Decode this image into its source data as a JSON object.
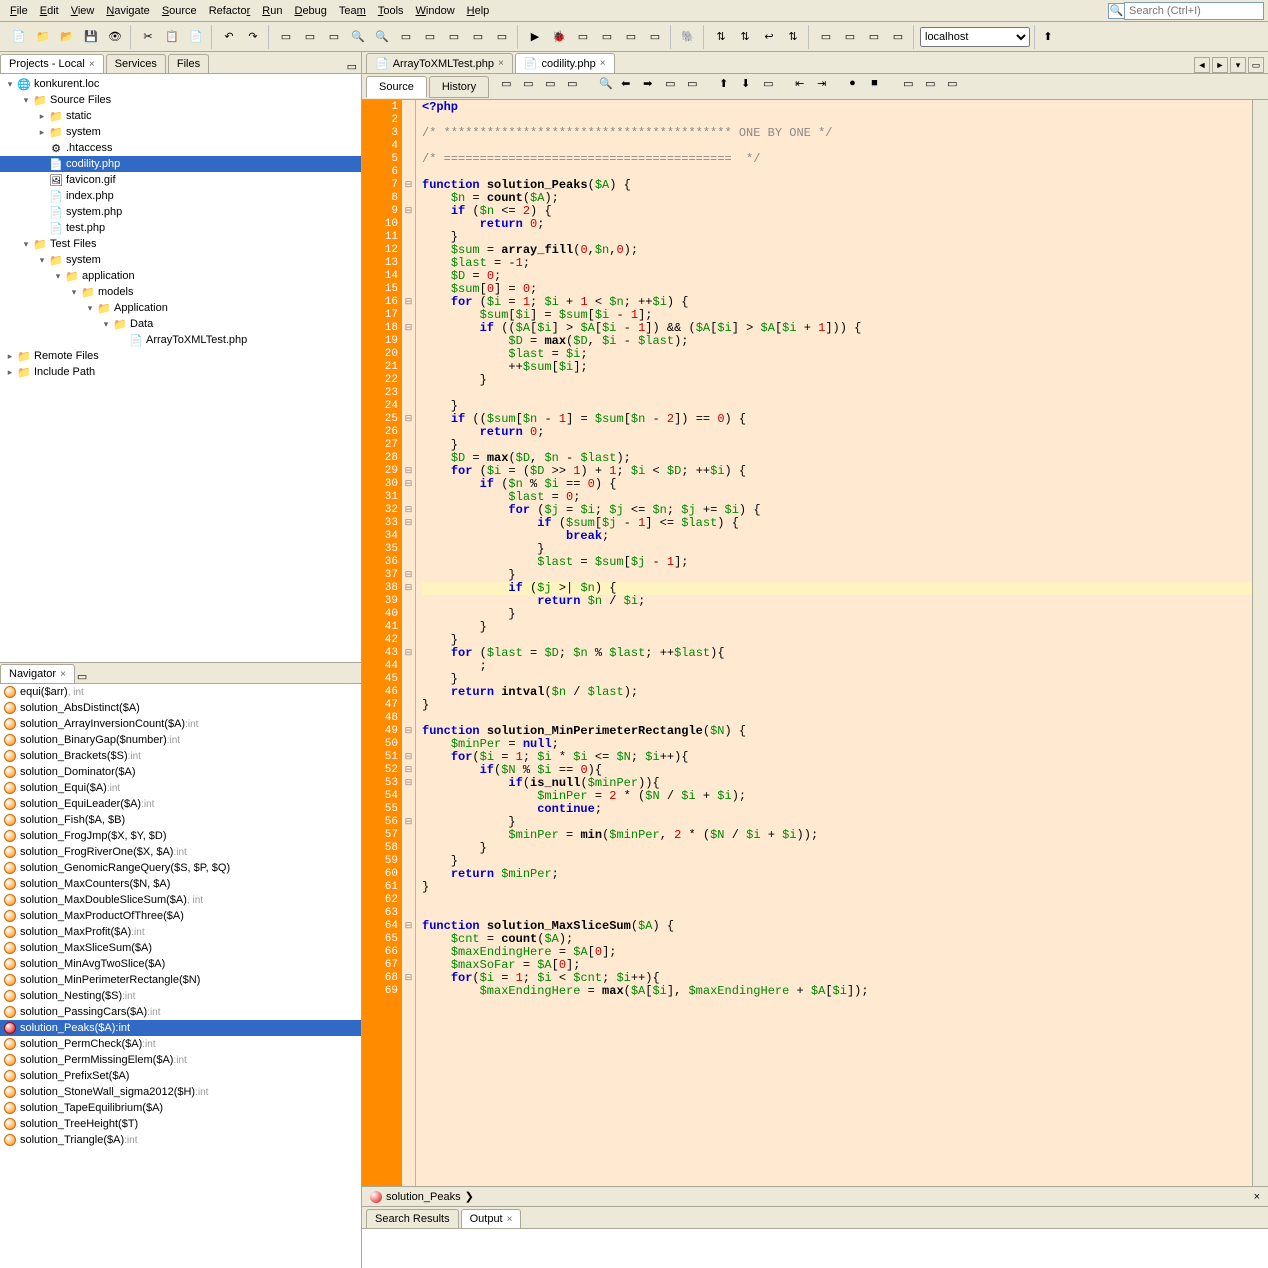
{
  "menu": [
    "File",
    "Edit",
    "View",
    "Navigate",
    "Source",
    "Refactor",
    "Run",
    "Debug",
    "Team",
    "Tools",
    "Window",
    "Help"
  ],
  "search_placeholder": "Search (Ctrl+I)",
  "host_select": "localhost",
  "left_tabs": {
    "projects": "Projects - Local",
    "services": "Services",
    "files": "Files"
  },
  "project_tree": [
    {
      "indent": 0,
      "toggle": "▾",
      "icon": "project",
      "label": "konkurent.loc"
    },
    {
      "indent": 1,
      "toggle": "▾",
      "icon": "folder",
      "label": "Source Files"
    },
    {
      "indent": 2,
      "toggle": "▸",
      "icon": "folder",
      "label": "static"
    },
    {
      "indent": 2,
      "toggle": "▸",
      "icon": "folder",
      "label": "system"
    },
    {
      "indent": 2,
      "toggle": "",
      "icon": "htaccess",
      "label": ".htaccess"
    },
    {
      "indent": 2,
      "toggle": "",
      "icon": "php",
      "label": "codility.php",
      "selected": true
    },
    {
      "indent": 2,
      "toggle": "",
      "icon": "img",
      "label": "favicon.gif"
    },
    {
      "indent": 2,
      "toggle": "",
      "icon": "php",
      "label": "index.php"
    },
    {
      "indent": 2,
      "toggle": "",
      "icon": "php",
      "label": "system.php"
    },
    {
      "indent": 2,
      "toggle": "",
      "icon": "php",
      "label": "test.php"
    },
    {
      "indent": 1,
      "toggle": "▾",
      "icon": "tests",
      "label": "Test Files"
    },
    {
      "indent": 2,
      "toggle": "▾",
      "icon": "folder",
      "label": "system"
    },
    {
      "indent": 3,
      "toggle": "▾",
      "icon": "folder",
      "label": "application"
    },
    {
      "indent": 4,
      "toggle": "▾",
      "icon": "folder",
      "label": "models"
    },
    {
      "indent": 5,
      "toggle": "▾",
      "icon": "folder",
      "label": "Application"
    },
    {
      "indent": 6,
      "toggle": "▾",
      "icon": "folder",
      "label": "Data"
    },
    {
      "indent": 7,
      "toggle": "",
      "icon": "php",
      "label": "ArrayToXMLTest.php"
    },
    {
      "indent": 0,
      "toggle": "▸",
      "icon": "remote",
      "label": "Remote Files"
    },
    {
      "indent": 0,
      "toggle": "▸",
      "icon": "include",
      "label": "Include Path"
    }
  ],
  "navigator_title": "Navigator",
  "nav_items": [
    {
      "b": "orange",
      "name": "equi($arr)",
      "ret": ", int"
    },
    {
      "b": "orange",
      "name": "solution_AbsDistinct($A)",
      "ret": ""
    },
    {
      "b": "orange",
      "name": "solution_ArrayInversionCount($A)",
      "ret": ":int"
    },
    {
      "b": "orange",
      "name": "solution_BinaryGap($number)",
      "ret": ":int"
    },
    {
      "b": "orange",
      "name": "solution_Brackets($S)",
      "ret": ":int"
    },
    {
      "b": "orange",
      "name": "solution_Dominator($A)",
      "ret": ""
    },
    {
      "b": "orange",
      "name": "solution_Equi($A)",
      "ret": ":int"
    },
    {
      "b": "orange",
      "name": "solution_EquiLeader($A)",
      "ret": ":int"
    },
    {
      "b": "orange",
      "name": "solution_Fish($A, $B)",
      "ret": ""
    },
    {
      "b": "orange",
      "name": "solution_FrogJmp($X, $Y, $D)",
      "ret": ""
    },
    {
      "b": "orange",
      "name": "solution_FrogRiverOne($X, $A)",
      "ret": ":int"
    },
    {
      "b": "orange",
      "name": "solution_GenomicRangeQuery($S, $P, $Q)",
      "ret": ""
    },
    {
      "b": "orange",
      "name": "solution_MaxCounters($N, $A)",
      "ret": ""
    },
    {
      "b": "orange",
      "name": "solution_MaxDoubleSliceSum($A)",
      "ret": ", int"
    },
    {
      "b": "orange",
      "name": "solution_MaxProductOfThree($A)",
      "ret": ""
    },
    {
      "b": "orange",
      "name": "solution_MaxProfit($A)",
      "ret": ":int"
    },
    {
      "b": "orange",
      "name": "solution_MaxSliceSum($A)",
      "ret": ""
    },
    {
      "b": "orange",
      "name": "solution_MinAvgTwoSlice($A)",
      "ret": ""
    },
    {
      "b": "orange",
      "name": "solution_MinPerimeterRectangle($N)",
      "ret": ""
    },
    {
      "b": "orange",
      "name": "solution_Nesting($S)",
      "ret": ":int"
    },
    {
      "b": "orange",
      "name": "solution_PassingCars($A)",
      "ret": ":int"
    },
    {
      "b": "red",
      "name": "solution_Peaks($A):int",
      "ret": "",
      "selected": true
    },
    {
      "b": "orange",
      "name": "solution_PermCheck($A)",
      "ret": ":int"
    },
    {
      "b": "orange",
      "name": "solution_PermMissingElem($A)",
      "ret": ":int"
    },
    {
      "b": "orange",
      "name": "solution_PrefixSet($A)",
      "ret": ""
    },
    {
      "b": "orange",
      "name": "solution_StoneWall_sigma2012($H)",
      "ret": ":int"
    },
    {
      "b": "orange",
      "name": "solution_TapeEquilibrium($A)",
      "ret": ""
    },
    {
      "b": "orange",
      "name": "solution_TreeHeight($T)",
      "ret": ""
    },
    {
      "b": "orange",
      "name": "solution_Triangle($A)",
      "ret": ":int"
    }
  ],
  "editor_tabs": [
    {
      "icon": "php",
      "label": "ArrayToXMLTest.php"
    },
    {
      "icon": "php",
      "label": "codility.php",
      "active": true
    }
  ],
  "view_tabs": {
    "source": "Source",
    "history": "History"
  },
  "first_line": 1,
  "breadcrumb": "solution_Peaks",
  "bottom_tabs": {
    "search": "Search Results",
    "output": "Output"
  }
}
